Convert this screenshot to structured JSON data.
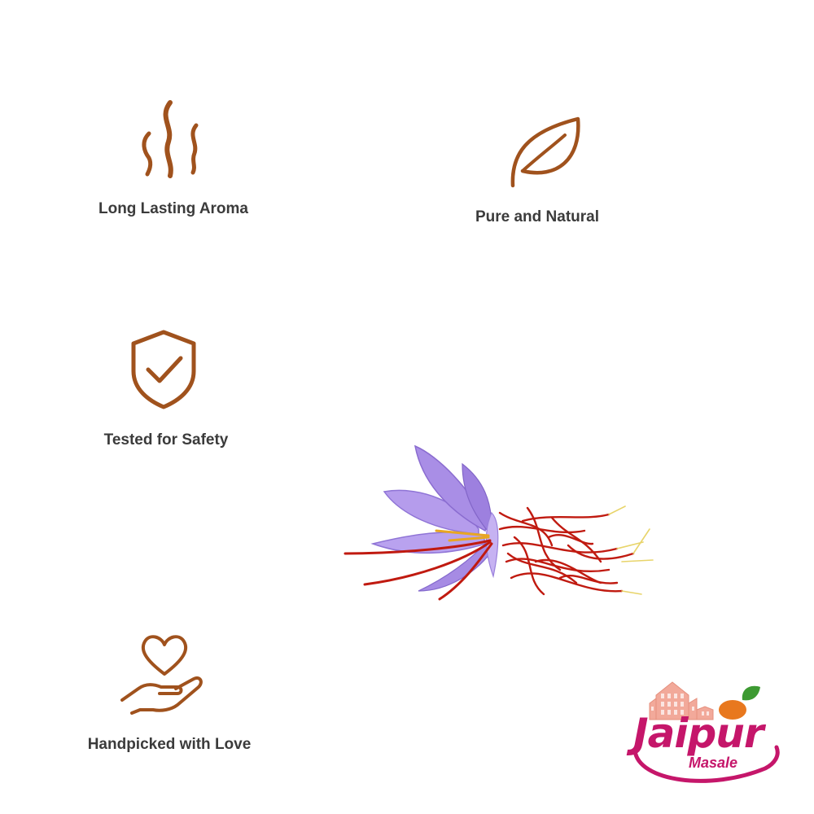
{
  "features": [
    {
      "label": "Long Lasting Aroma",
      "icon": "aroma-steam-icon"
    },
    {
      "label": "Pure and Natural",
      "icon": "leaf-icon"
    },
    {
      "label": "Tested for Safety",
      "icon": "shield-check-icon"
    },
    {
      "label": "Handpicked with Love",
      "icon": "heart-hand-icon"
    }
  ],
  "brand": {
    "name": "Jaipur",
    "tagline": "Masale"
  },
  "colors": {
    "icon": "#a0521d",
    "label": "#3b3b3b",
    "brand": "#c5166a",
    "brand_accent": "#e8781e",
    "petal": "#a98ee6",
    "stigma": "#c01a10"
  },
  "image": {
    "subject": "saffron-flower-illustration"
  }
}
